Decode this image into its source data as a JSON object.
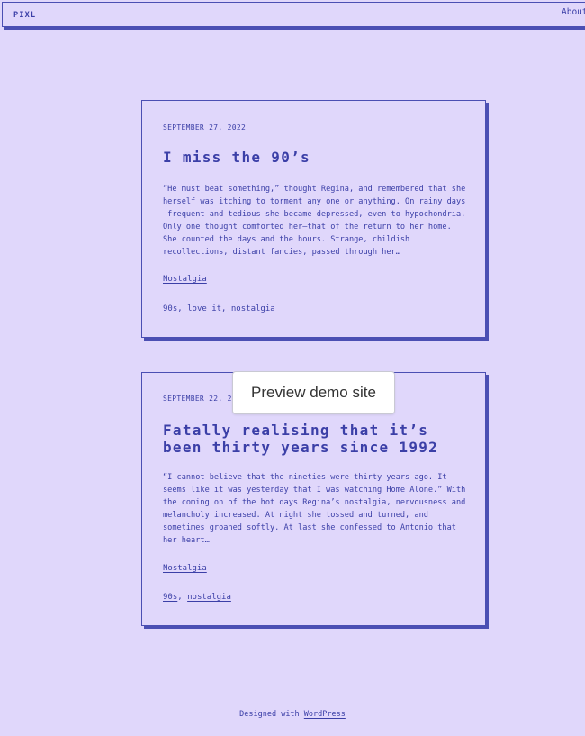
{
  "header": {
    "logo": "PIXL",
    "nav": {
      "about": "About"
    }
  },
  "posts": [
    {
      "date": "SEPTEMBER 27, 2022",
      "title": "I miss the 90’s",
      "excerpt": "“He must beat something,” thought Regina, and remembered that she herself was itching to torment any one or anything. On rainy days—frequent and tedious—she became depressed, even to hypochondria. Only one thought comforted her—that of the return to her home. She counted the days and the hours. Strange, childish recollections, distant fancies, passed through her…",
      "category": "Nostalgia",
      "tags": [
        "90s",
        "love it",
        "nostalgia"
      ]
    },
    {
      "date": "SEPTEMBER 22, 2022",
      "title": "Fatally realising that it’s been thirty years since 1992",
      "excerpt": "“I cannot believe that the nineties were thirty years ago. It seems like it was yesterday that I was watching Home Alone.” With the coming on of the hot days Regina’s nostalgia, nervousness and melancholy increased. At night she tossed and turned, and sometimes groaned softly. At last she confessed to Antonio that her heart…",
      "category": "Nostalgia",
      "tags": [
        "90s",
        "nostalgia"
      ]
    }
  ],
  "overlay": {
    "preview_button": "Preview demo site"
  },
  "footer": {
    "prefix": "Designed with ",
    "link": "WordPress"
  },
  "colors": {
    "background": "#e0d7fb",
    "accent": "#3b3fa7",
    "border": "#4b4fb3"
  }
}
